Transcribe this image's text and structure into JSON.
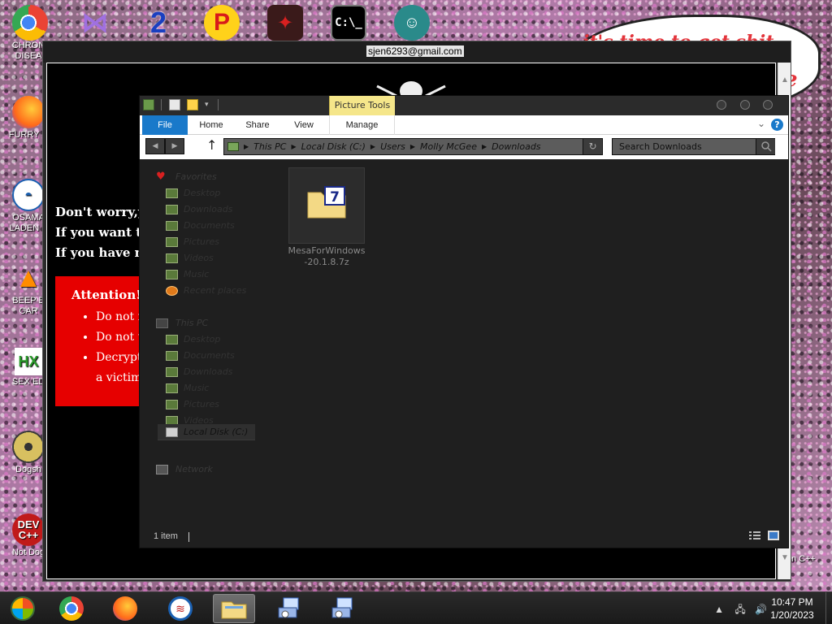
{
  "desktop": {
    "left_icons": [
      {
        "label": "CHRON\nDISEA",
        "name": "chrome"
      },
      {
        "label": "FURRY C",
        "name": "firefox"
      },
      {
        "label": "OSAMA\nLADEN E",
        "name": "obama"
      },
      {
        "label": "BEEP B\nCAR",
        "name": "vlc"
      },
      {
        "label": "SEX ED",
        "name": "hx"
      },
      {
        "label": "Dogsh",
        "name": "disc"
      },
      {
        "label": "Not Dog",
        "name": "devcpp"
      }
    ],
    "top_icons": [
      "chrome",
      "visual-studio",
      "two",
      "p-game",
      "bird",
      "cmd",
      "santa"
    ],
    "speech_text": "it's time to get shit",
    "speech_fragment": "te",
    "right_label": "n C++"
  },
  "ransom": {
    "title": "sjen6293@gmail.com",
    "lines": [
      "Don't worry,yo",
      "If you want to",
      "If you have no"
    ],
    "attention": {
      "heading": "Attention!",
      "items": [
        "Do not r",
        "Do not t",
        "Decryptic"
      ],
      "continuation": "a victim"
    }
  },
  "explorer": {
    "picture_tools": "Picture Tools",
    "tabs": [
      "File",
      "Home",
      "Share",
      "View",
      "Manage"
    ],
    "breadcrumb": [
      "This PC",
      "Local Disk (C:)",
      "Users",
      "Molly McGee",
      "Downloads"
    ],
    "search_placeholder": "Search Downloads",
    "nav": {
      "favorites_label": "Favorites",
      "favorites": [
        "Desktop",
        "Downloads",
        "Documents",
        "Pictures",
        "Videos",
        "Music",
        "Recent places"
      ],
      "thispc_label": "This PC",
      "thispc": [
        "Desktop",
        "Documents",
        "Downloads",
        "Music",
        "Pictures",
        "Videos",
        "Local Disk (C:)"
      ],
      "network_label": "Network"
    },
    "file": {
      "name": "MesaForWindows-20.1.8.7z",
      "badge": "7"
    },
    "status": "1 item"
  },
  "taskbar": {
    "apps": [
      "start",
      "chrome",
      "firefox",
      "obama",
      "file-explorer",
      "app-installer-1",
      "app-installer-2"
    ],
    "active_index": 4,
    "time": "10:47 PM",
    "date": "1/20/2023"
  },
  "colors": {
    "accent_blue": "#1979ca",
    "ransom_red": "#e60000",
    "picture_tools_yellow": "#f5e68a"
  }
}
